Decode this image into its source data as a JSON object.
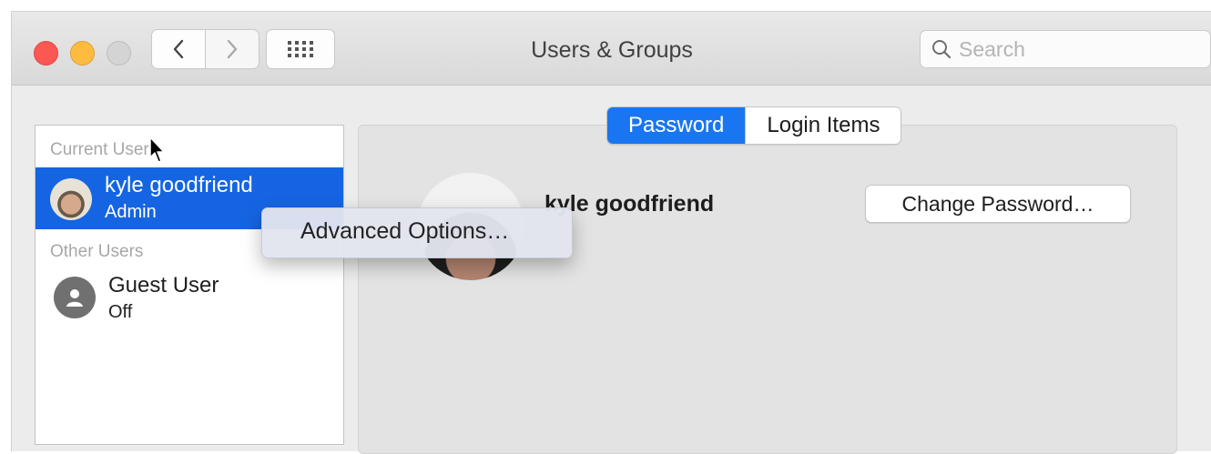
{
  "window": {
    "title": "Users & Groups",
    "search_placeholder": "Search"
  },
  "sidebar": {
    "current_user_header": "Current User",
    "current_user": {
      "name": "kyle goodfriend",
      "role": "Admin"
    },
    "other_users_header": "Other Users",
    "other_users": [
      {
        "name": "Guest User",
        "status": "Off"
      }
    ]
  },
  "tabs": {
    "items": [
      {
        "label": "Password",
        "active": true
      },
      {
        "label": "Login Items",
        "active": false
      }
    ]
  },
  "detail": {
    "user_full_name": "kyle goodfriend",
    "change_password_label": "Change Password…"
  },
  "context_menu": {
    "items": [
      "Advanced Options…"
    ]
  },
  "colors": {
    "accent": "#1565e3",
    "close": "#fc5753",
    "minimize": "#fdbc40"
  }
}
